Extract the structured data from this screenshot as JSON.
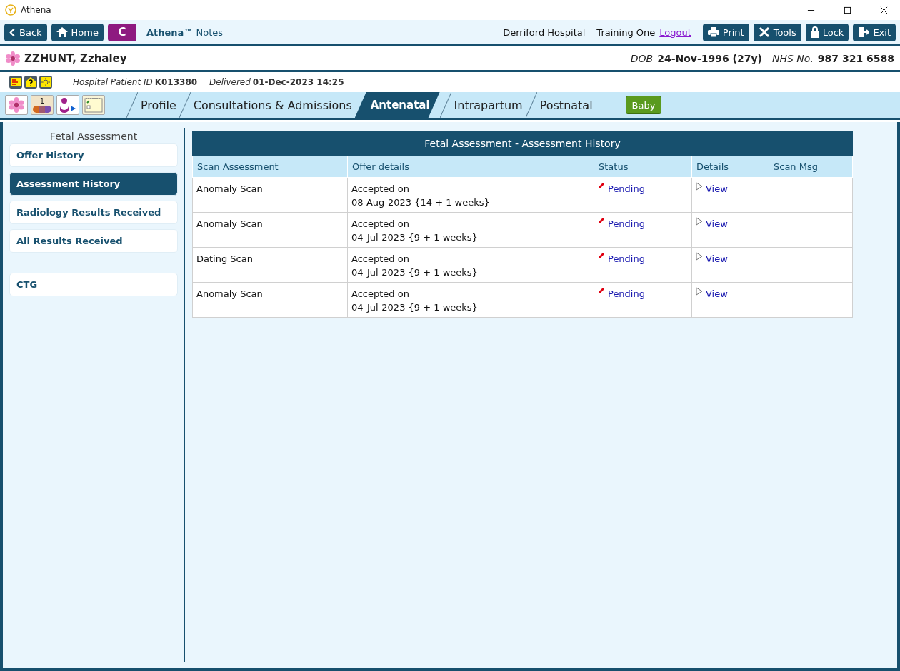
{
  "window": {
    "title": "Athena"
  },
  "toolbar": {
    "left_buttons": [
      {
        "label": "Back",
        "kind": "back"
      },
      {
        "label": "Home",
        "kind": "home"
      },
      {
        "label": "C",
        "kind": "letter"
      }
    ],
    "app_name": "**Athena™** Notes",
    "location": "Derriford Hospital",
    "user": "Training One",
    "logout": "Logout",
    "right_buttons": [
      {
        "label": "Print",
        "kind": "print"
      },
      {
        "label": "Tools",
        "kind": "tools"
      },
      {
        "label": "Lock",
        "kind": "lock"
      },
      {
        "label": "Exit",
        "kind": "exit"
      }
    ]
  },
  "patient": {
    "name": "ZZHUNT, Zzhaley",
    "dob_label": "DOB",
    "dob": "24-Nov-1996 (27y)",
    "nhs_label": "NHS No.",
    "nhs": "987 321 6588"
  },
  "info": {
    "id_label": "Hospital Patient ID",
    "id": "K013380",
    "delivered_label": "Delivered",
    "delivered": "01-Dec-2023 14:25"
  },
  "pill_badge": "1",
  "tabs": [
    {
      "label": "Profile",
      "selected": false
    },
    {
      "label": "Consultations & Admissions",
      "selected": false
    },
    {
      "label": "Antenatal",
      "selected": true
    },
    {
      "label": "Intrapartum",
      "selected": false
    },
    {
      "label": "Postnatal",
      "selected": false
    }
  ],
  "baby_button": "Baby",
  "sidebar": {
    "title": "Fetal Assessment",
    "sections": [
      {
        "items": [
          {
            "label": "Offer History",
            "selected": false
          },
          {
            "label": "Assessment History",
            "selected": true
          },
          {
            "label": "Radiology Results Received",
            "selected": false
          },
          {
            "label": "All Results Received",
            "selected": false
          }
        ]
      },
      {
        "items": [
          {
            "label": "CTG",
            "selected": false
          }
        ]
      }
    ]
  },
  "table": {
    "title": "Fetal Assessment - Assessment History",
    "columns": [
      "Scan Assessment",
      "Offer details",
      "Status",
      "Details",
      "Scan Msg"
    ],
    "rows": [
      {
        "scan": "Anomaly Scan",
        "offer": "Accepted on",
        "offer_date": "08-Aug-2023 {14 + 1 weeks}",
        "status": "Pending",
        "details": "View"
      },
      {
        "scan": "Anomaly Scan",
        "offer": "Accepted on",
        "offer_date": "04-Jul-2023 {9 + 1 weeks}",
        "status": "Pending",
        "details": "View"
      },
      {
        "scan": "Dating Scan",
        "offer": "Accepted on",
        "offer_date": "04-Jul-2023 {9 + 1 weeks}",
        "status": "Pending",
        "details": "View"
      },
      {
        "scan": "Anomaly Scan",
        "offer": "Accepted on",
        "offer_date": "04-Jul-2023 {9 + 1 weeks}",
        "status": "Pending",
        "details": "View"
      }
    ]
  }
}
